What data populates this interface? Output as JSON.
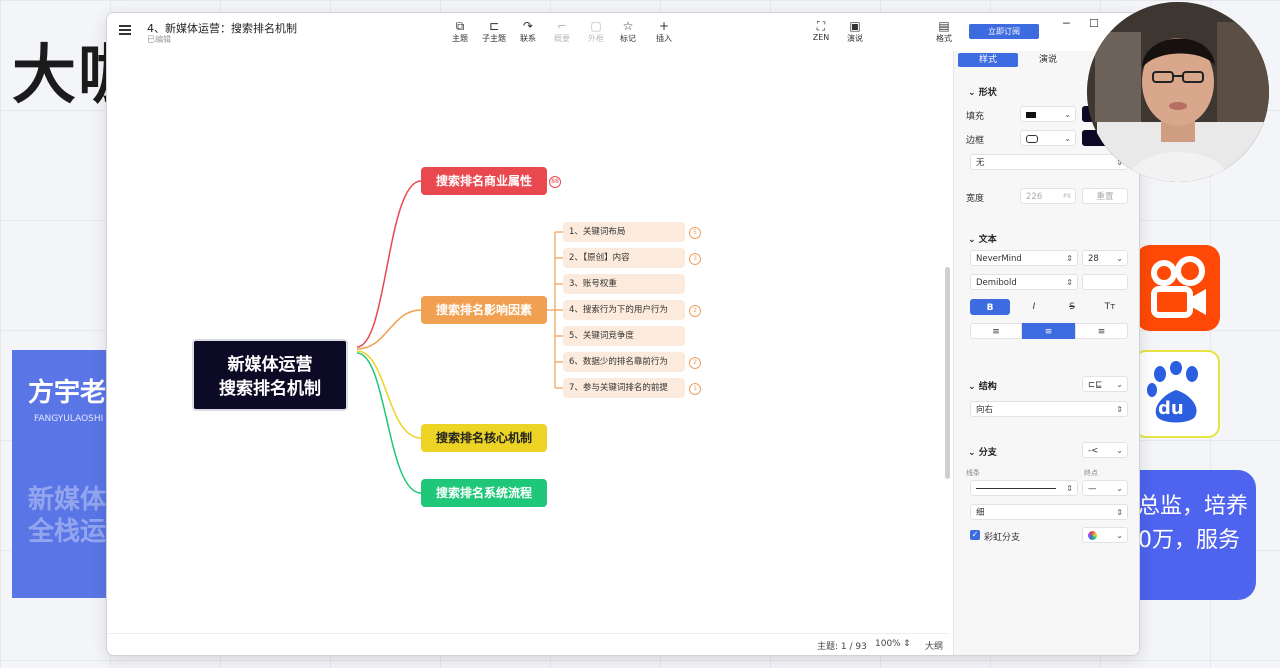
{
  "background": {
    "headline": "大咖",
    "presenter_name": "方宇老",
    "presenter_sub": "FANGYULAOSHI",
    "ghost_line1": "新媒体",
    "ghost_line2": "全栈运",
    "right_text_line1": "总监，培养",
    "right_text_line2": "0万，服务",
    "baidu_text": "du"
  },
  "window": {
    "doc_title": "4、新媒体运营：搜索排名机制",
    "doc_status": "已编辑",
    "toolbar": [
      {
        "label": "主题",
        "icon": "topic-icon",
        "glyph": "⧉",
        "enabled": true
      },
      {
        "label": "子主题",
        "icon": "subtopic-icon",
        "glyph": "⊏",
        "enabled": true
      },
      {
        "label": "联系",
        "icon": "relationship-icon",
        "glyph": "↷",
        "enabled": true
      },
      {
        "label": "概要",
        "icon": "summary-icon",
        "glyph": "⌐",
        "enabled": false
      },
      {
        "label": "外框",
        "icon": "boundary-icon",
        "glyph": "▢",
        "enabled": false
      },
      {
        "label": "标记",
        "icon": "marker-icon",
        "glyph": "☆",
        "enabled": true
      },
      {
        "label": "插入",
        "icon": "insert-icon",
        "glyph": "+",
        "enabled": true
      },
      {
        "label": "ZEN",
        "icon": "zen-icon",
        "glyph": "⛶",
        "enabled": true
      },
      {
        "label": "演说",
        "icon": "pitch-icon",
        "glyph": "▣",
        "enabled": true
      }
    ],
    "format_toggle": "格式",
    "subscribe_label": "立即订阅",
    "statusbar": {
      "topic_count": "主题: 1 / 93",
      "zoom": "100%",
      "outline": "大纲"
    }
  },
  "mindmap": {
    "central_line1": "新媒体运营",
    "central_line2": "搜索排名机制",
    "branches": [
      {
        "label": "搜索排名商业属性",
        "color": "#e9484e",
        "badge": "88"
      },
      {
        "label": "搜索排名影响因素",
        "color": "#f0a050"
      },
      {
        "label": "搜索排名核心机制",
        "color": "#ecd324"
      },
      {
        "label": "搜索排名系统流程",
        "color": "#1fc878"
      }
    ],
    "subtopics": [
      {
        "label": "1、关键词布局",
        "badge": "5"
      },
      {
        "label": "2、【原创】内容",
        "badge": "3"
      },
      {
        "label": "3、账号权重",
        "badge": ""
      },
      {
        "label": "4、搜索行为下的用户行为",
        "badge": "2"
      },
      {
        "label": "5、关键词竞争度",
        "badge": ""
      },
      {
        "label": "6、数据少的排名靠前行为",
        "badge": "2"
      },
      {
        "label": "7、参与关键词排名的前提",
        "badge": "1"
      }
    ]
  },
  "panel": {
    "tabs": [
      "样式",
      "演说"
    ],
    "shape_section": "形状",
    "fill_label": "填充",
    "border_label": "边框",
    "line_none": "无",
    "width_label": "宽度",
    "width_value": "226",
    "width_unit": "PX",
    "width_reset": "重置",
    "text_section": "文本",
    "font_family": "NeverMind",
    "font_size": "28",
    "font_weight": "Demibold",
    "bold": "B",
    "italic": "I",
    "strike": "S",
    "case": "Tт",
    "structure_section": "结构",
    "structure_value": "向右",
    "branch_section": "分支",
    "line_label": "线条",
    "end_label": "终点",
    "thickness": "细",
    "rainbow_label": "彩虹分支",
    "rainbow_checked": true
  }
}
